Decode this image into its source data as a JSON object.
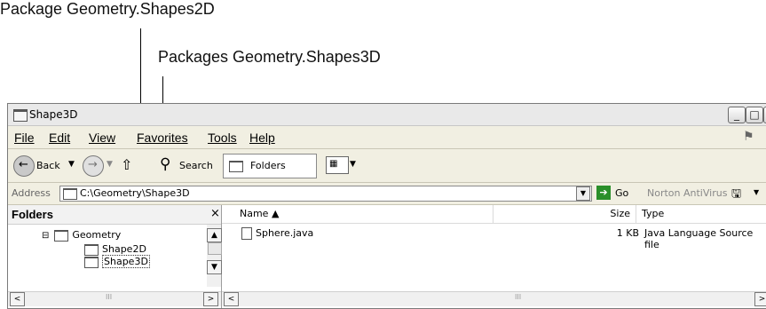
{
  "callouts": {
    "top": "Package Geometry.Shapes2D",
    "second": "Packages Geometry.Shapes3D"
  },
  "window": {
    "title": "Shape3D",
    "minimize": "_",
    "maximize": "□",
    "close": "X"
  },
  "menu": {
    "file": "File",
    "edit": "Edit",
    "view": "View",
    "favorites": "Favorites",
    "tools": "Tools",
    "help": "Help"
  },
  "toolbar": {
    "back_label": "Back",
    "search_label": "Search",
    "folders_label": "Folders"
  },
  "address": {
    "label": "Address",
    "value": "C:\\Geometry\\Shape3D",
    "go_label": "Go",
    "norton": "Norton AntiVirus"
  },
  "folders_pane": {
    "header": "Folders",
    "close": "×",
    "tree": [
      {
        "label": "Geometry",
        "expander": "⊟"
      },
      {
        "label": "Shape2D"
      },
      {
        "label": "Shape3D",
        "selected": true
      }
    ]
  },
  "file_list": {
    "columns": {
      "name": "Name ▲",
      "size": "Size",
      "type": "Type"
    },
    "rows": [
      {
        "name": "Sphere.java",
        "size": "1 KB",
        "type": "Java Language Source file"
      }
    ]
  },
  "scrollbars": {
    "left": "<",
    "right": ">",
    "up": "▲",
    "down": "▼",
    "grip": "III"
  },
  "colors": {
    "chrome": "#ece9d8",
    "selected_bg": "#ffffff",
    "border": "#7a7a7a"
  }
}
